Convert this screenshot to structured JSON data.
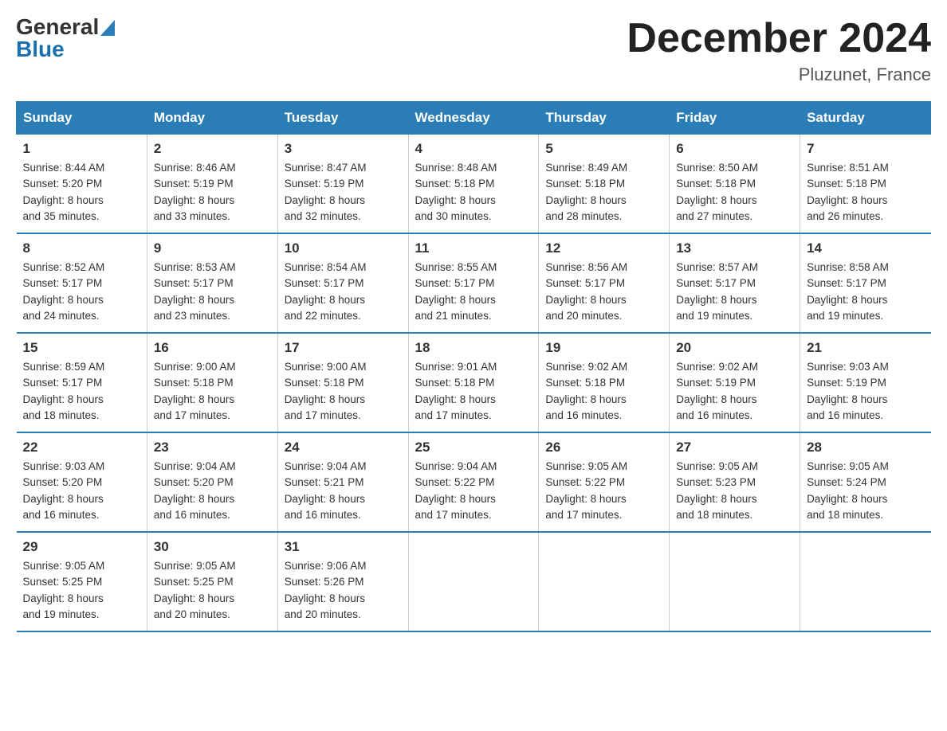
{
  "header": {
    "logo_general": "General",
    "logo_blue": "Blue",
    "main_title": "December 2024",
    "subtitle": "Pluzunet, France"
  },
  "calendar": {
    "days_of_week": [
      "Sunday",
      "Monday",
      "Tuesday",
      "Wednesday",
      "Thursday",
      "Friday",
      "Saturday"
    ],
    "weeks": [
      [
        {
          "day": "1",
          "sunrise": "8:44 AM",
          "sunset": "5:20 PM",
          "daylight": "8 hours and 35 minutes."
        },
        {
          "day": "2",
          "sunrise": "8:46 AM",
          "sunset": "5:19 PM",
          "daylight": "8 hours and 33 minutes."
        },
        {
          "day": "3",
          "sunrise": "8:47 AM",
          "sunset": "5:19 PM",
          "daylight": "8 hours and 32 minutes."
        },
        {
          "day": "4",
          "sunrise": "8:48 AM",
          "sunset": "5:18 PM",
          "daylight": "8 hours and 30 minutes."
        },
        {
          "day": "5",
          "sunrise": "8:49 AM",
          "sunset": "5:18 PM",
          "daylight": "8 hours and 28 minutes."
        },
        {
          "day": "6",
          "sunrise": "8:50 AM",
          "sunset": "5:18 PM",
          "daylight": "8 hours and 27 minutes."
        },
        {
          "day": "7",
          "sunrise": "8:51 AM",
          "sunset": "5:18 PM",
          "daylight": "8 hours and 26 minutes."
        }
      ],
      [
        {
          "day": "8",
          "sunrise": "8:52 AM",
          "sunset": "5:17 PM",
          "daylight": "8 hours and 24 minutes."
        },
        {
          "day": "9",
          "sunrise": "8:53 AM",
          "sunset": "5:17 PM",
          "daylight": "8 hours and 23 minutes."
        },
        {
          "day": "10",
          "sunrise": "8:54 AM",
          "sunset": "5:17 PM",
          "daylight": "8 hours and 22 minutes."
        },
        {
          "day": "11",
          "sunrise": "8:55 AM",
          "sunset": "5:17 PM",
          "daylight": "8 hours and 21 minutes."
        },
        {
          "day": "12",
          "sunrise": "8:56 AM",
          "sunset": "5:17 PM",
          "daylight": "8 hours and 20 minutes."
        },
        {
          "day": "13",
          "sunrise": "8:57 AM",
          "sunset": "5:17 PM",
          "daylight": "8 hours and 19 minutes."
        },
        {
          "day": "14",
          "sunrise": "8:58 AM",
          "sunset": "5:17 PM",
          "daylight": "8 hours and 19 minutes."
        }
      ],
      [
        {
          "day": "15",
          "sunrise": "8:59 AM",
          "sunset": "5:17 PM",
          "daylight": "8 hours and 18 minutes."
        },
        {
          "day": "16",
          "sunrise": "9:00 AM",
          "sunset": "5:18 PM",
          "daylight": "8 hours and 17 minutes."
        },
        {
          "day": "17",
          "sunrise": "9:00 AM",
          "sunset": "5:18 PM",
          "daylight": "8 hours and 17 minutes."
        },
        {
          "day": "18",
          "sunrise": "9:01 AM",
          "sunset": "5:18 PM",
          "daylight": "8 hours and 17 minutes."
        },
        {
          "day": "19",
          "sunrise": "9:02 AM",
          "sunset": "5:18 PM",
          "daylight": "8 hours and 16 minutes."
        },
        {
          "day": "20",
          "sunrise": "9:02 AM",
          "sunset": "5:19 PM",
          "daylight": "8 hours and 16 minutes."
        },
        {
          "day": "21",
          "sunrise": "9:03 AM",
          "sunset": "5:19 PM",
          "daylight": "8 hours and 16 minutes."
        }
      ],
      [
        {
          "day": "22",
          "sunrise": "9:03 AM",
          "sunset": "5:20 PM",
          "daylight": "8 hours and 16 minutes."
        },
        {
          "day": "23",
          "sunrise": "9:04 AM",
          "sunset": "5:20 PM",
          "daylight": "8 hours and 16 minutes."
        },
        {
          "day": "24",
          "sunrise": "9:04 AM",
          "sunset": "5:21 PM",
          "daylight": "8 hours and 16 minutes."
        },
        {
          "day": "25",
          "sunrise": "9:04 AM",
          "sunset": "5:22 PM",
          "daylight": "8 hours and 17 minutes."
        },
        {
          "day": "26",
          "sunrise": "9:05 AM",
          "sunset": "5:22 PM",
          "daylight": "8 hours and 17 minutes."
        },
        {
          "day": "27",
          "sunrise": "9:05 AM",
          "sunset": "5:23 PM",
          "daylight": "8 hours and 18 minutes."
        },
        {
          "day": "28",
          "sunrise": "9:05 AM",
          "sunset": "5:24 PM",
          "daylight": "8 hours and 18 minutes."
        }
      ],
      [
        {
          "day": "29",
          "sunrise": "9:05 AM",
          "sunset": "5:25 PM",
          "daylight": "8 hours and 19 minutes."
        },
        {
          "day": "30",
          "sunrise": "9:05 AM",
          "sunset": "5:25 PM",
          "daylight": "8 hours and 20 minutes."
        },
        {
          "day": "31",
          "sunrise": "9:06 AM",
          "sunset": "5:26 PM",
          "daylight": "8 hours and 20 minutes."
        },
        null,
        null,
        null,
        null
      ]
    ],
    "labels": {
      "sunrise": "Sunrise:",
      "sunset": "Sunset:",
      "daylight": "Daylight:"
    }
  }
}
